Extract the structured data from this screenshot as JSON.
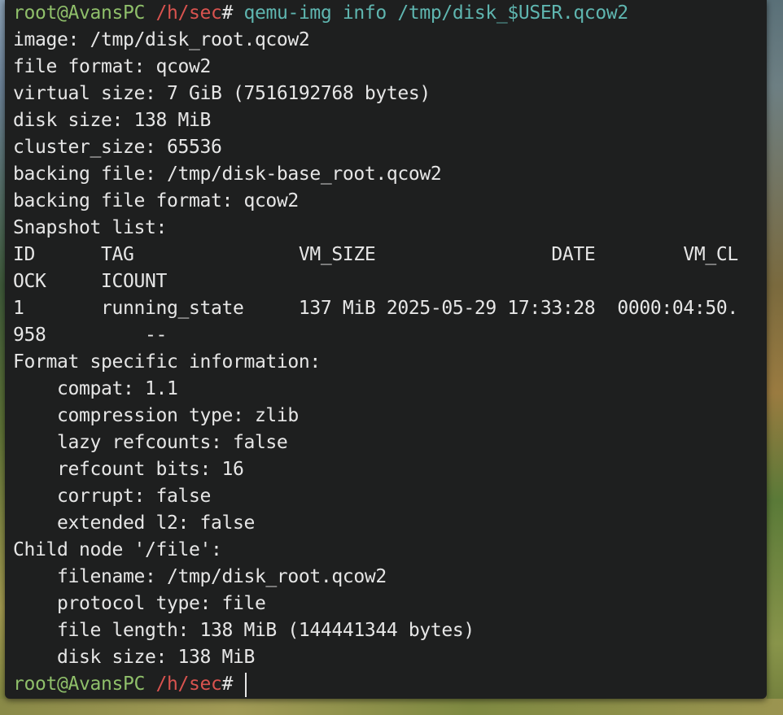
{
  "terminal": {
    "prompt": {
      "user_host": "root@AvansPC",
      "path": "/h/sec",
      "symbol": "#"
    },
    "command": "qemu-img info /tmp/disk_$USER.qcow2",
    "output": [
      "image: /tmp/disk_root.qcow2",
      "file format: qcow2",
      "virtual size: 7 GiB (7516192768 bytes)",
      "disk size: 138 MiB",
      "cluster_size: 65536",
      "backing file: /tmp/disk-base_root.qcow2",
      "backing file format: qcow2",
      "Snapshot list:",
      "ID      TAG               VM_SIZE                DATE        VM_CL",
      "OCK     ICOUNT",
      "1       running_state     137 MiB 2025-05-29 17:33:28  0000:04:50.",
      "958         --",
      "Format specific information:",
      "    compat: 1.1",
      "    compression type: zlib",
      "    lazy refcounts: false",
      "    refcount bits: 16",
      "    corrupt: false",
      "    extended l2: false",
      "Child node '/file':",
      "    filename: /tmp/disk_root.qcow2",
      "    protocol type: file",
      "    file length: 138 MiB (144441344 bytes)",
      "    disk size: 138 MiB"
    ]
  },
  "colors": {
    "background": "#1e1f1f",
    "text": "#e6e6e6",
    "prompt_user": "#8fbf6a",
    "prompt_path": "#d9534f",
    "command": "#5fb6b0"
  }
}
